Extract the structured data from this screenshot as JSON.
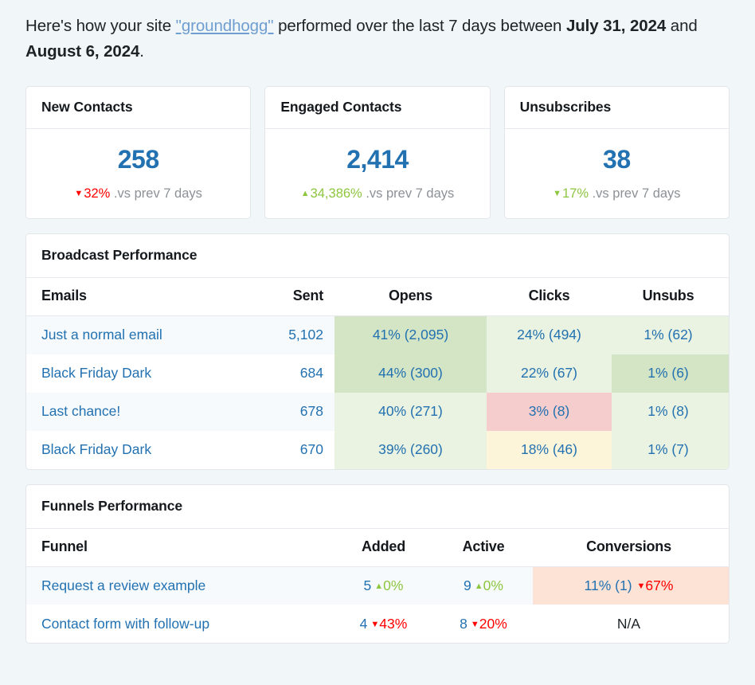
{
  "intro": {
    "part1": "Here's how your site ",
    "site_name": "\"groundhogg\"",
    "part2": " performed over the last 7 days between ",
    "date_start": "July 31, 2024",
    "part3": " and ",
    "date_end": "August 6, 2024",
    "part4": "."
  },
  "colors": {
    "page_background": "#f1f6f9",
    "link_blue": "#2271b1",
    "positive_green": "#8dc63f",
    "negative_red": "#ff0000",
    "muted_gray": "#8c9196",
    "heat_green_strong": "#d3e5c4",
    "heat_green_soft": "#eaf3e1",
    "heat_red": "#f5cdcd",
    "heat_yellow": "#fdf5da",
    "heat_peach": "#fde3d6"
  },
  "stats": [
    {
      "title": "New Contacts",
      "value": "258",
      "direction": "down",
      "tone": "bad",
      "delta": "32%",
      "compare_label": ".vs prev 7 days"
    },
    {
      "title": "Engaged Contacts",
      "value": "2,414",
      "direction": "up",
      "tone": "good",
      "delta": "34,386%",
      "compare_label": ".vs prev 7 days"
    },
    {
      "title": "Unsubscribes",
      "value": "38",
      "direction": "down",
      "tone": "good",
      "delta": "17%",
      "compare_label": ".vs prev 7 days"
    }
  ],
  "broadcast": {
    "title": "Broadcast Performance",
    "headers": [
      "Emails",
      "Sent",
      "Opens",
      "Clicks",
      "Unsubs"
    ],
    "rows": [
      {
        "name": "Just a normal email",
        "sent": "5,102",
        "opens": "41% (2,095)",
        "clicks": "24% (494)",
        "unsubs": "1% (62)"
      },
      {
        "name": "Black Friday Dark",
        "sent": "684",
        "opens": "44% (300)",
        "clicks": "22% (67)",
        "unsubs": "1% (6)"
      },
      {
        "name": "Last chance!",
        "sent": "678",
        "opens": "40% (271)",
        "clicks": "3% (8)",
        "unsubs": "1% (8)"
      },
      {
        "name": "Black Friday Dark",
        "sent": "670",
        "opens": "39% (260)",
        "clicks": "18% (46)",
        "unsubs": "1% (7)"
      }
    ]
  },
  "funnels": {
    "title": "Funnels Performance",
    "headers": [
      "Funnel",
      "Added",
      "Active",
      "Conversions"
    ],
    "rows": [
      {
        "name": "Request a review example",
        "added_value": "5",
        "added_delta": "0%",
        "added_direction": "up",
        "added_tone": "good",
        "active_value": "9",
        "active_delta": "0%",
        "active_direction": "up",
        "active_tone": "good",
        "conversions_value": "11% (1)",
        "conversions_delta": "67%",
        "conversions_direction": "down",
        "conversions_tone": "bad"
      },
      {
        "name": "Contact form with follow-up",
        "added_value": "4",
        "added_delta": "43%",
        "added_direction": "down",
        "added_tone": "bad",
        "active_value": "8",
        "active_delta": "20%",
        "active_direction": "down",
        "active_tone": "bad",
        "conversions_value": "N/A",
        "conversions_delta": "",
        "conversions_direction": "",
        "conversions_tone": ""
      }
    ]
  }
}
